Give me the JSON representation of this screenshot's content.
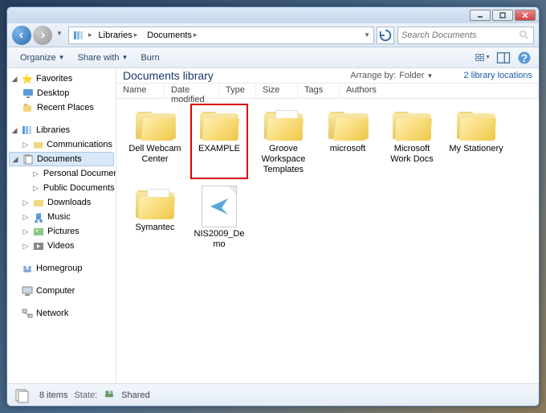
{
  "titlebar": {},
  "nav": {
    "breadcrumb": [
      "Libraries",
      "Documents"
    ],
    "search_placeholder": "Search Documents"
  },
  "toolbar": {
    "organize": "Organize",
    "share": "Share with",
    "burn": "Burn"
  },
  "sidebar": {
    "favorites": {
      "label": "Favorites",
      "items": [
        "Desktop",
        "Recent Places"
      ]
    },
    "libraries": {
      "label": "Libraries",
      "items": [
        "Communications",
        "Documents",
        "Downloads",
        "Music",
        "Pictures",
        "Videos"
      ],
      "documents_children": [
        "Personal Documents",
        "Public Documents"
      ]
    },
    "homegroup": "Homegroup",
    "computer": "Computer",
    "network": "Network"
  },
  "library_header": {
    "title": "Documents library",
    "arrange_label": "Arrange by:",
    "arrange_value": "Folder",
    "locations": "2 library locations"
  },
  "columns": [
    "Name",
    "Date modified",
    "Type",
    "Size",
    "Tags",
    "Authors"
  ],
  "files": [
    {
      "name": "Dell Webcam Center",
      "type": "folder-open"
    },
    {
      "name": "EXAMPLE",
      "type": "folder",
      "highlighted": true
    },
    {
      "name": "Groove Workspace Templates",
      "type": "folder-paper"
    },
    {
      "name": "microsoft",
      "type": "folder-open"
    },
    {
      "name": "Microsoft Work Docs",
      "type": "folder"
    },
    {
      "name": "My Stationery",
      "type": "folder"
    },
    {
      "name": "Symantec",
      "type": "folder-paper"
    },
    {
      "name": "NIS2009_Demo",
      "type": "file-plane"
    }
  ],
  "statusbar": {
    "count": "8 items",
    "state_label": "State:",
    "state_value": "Shared"
  }
}
